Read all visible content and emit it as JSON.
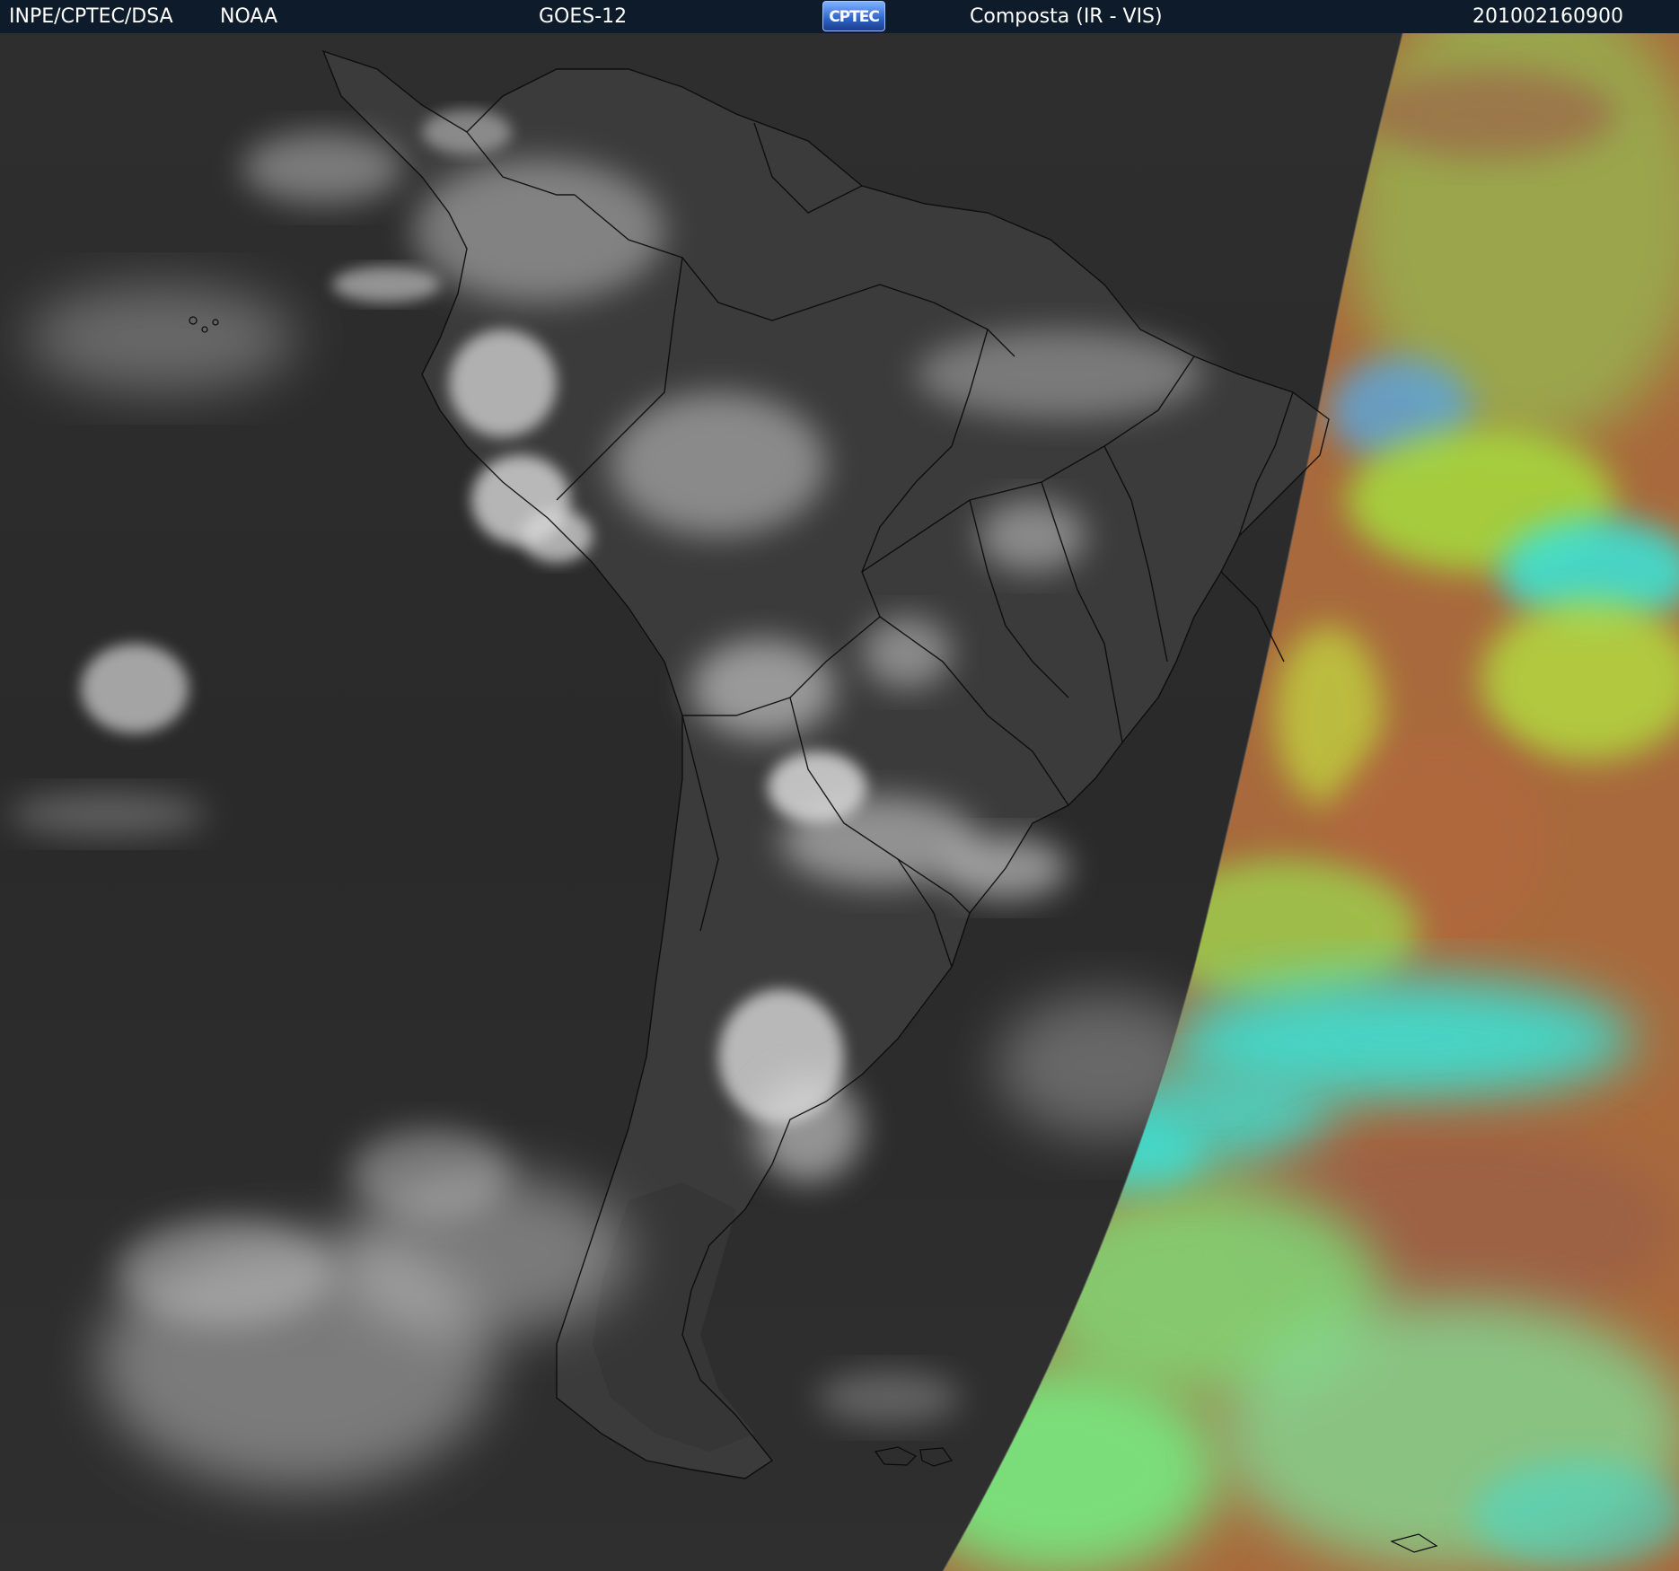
{
  "header": {
    "agency": "INPE/CPTEC/DSA",
    "source": "NOAA",
    "satellite": "GOES-12",
    "logo_text": "CPTEC",
    "product": "Composta (IR - VIS)",
    "timestamp": "201002160900"
  },
  "colors": {
    "header_background": "#0d1b2a",
    "ocean_ir": "#2b2b2b",
    "land_ir": "#3a3a3a",
    "cloud_ir": "#d9d9d9",
    "vis_land": "#b8643e",
    "vis_green": "#8ee85a",
    "vis_cyan": "#38e6dc",
    "coastline": "#000000"
  }
}
